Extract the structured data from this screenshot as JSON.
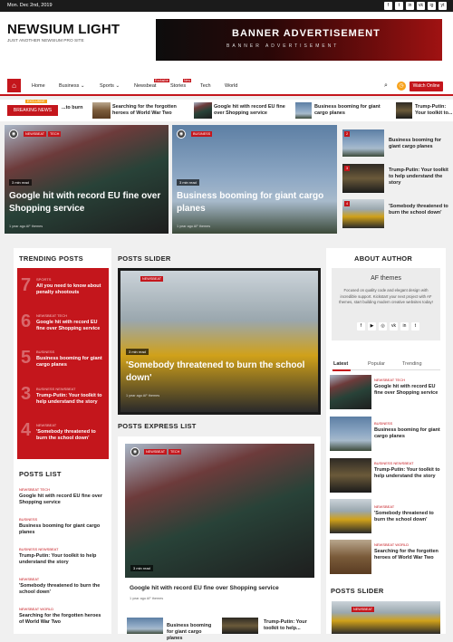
{
  "topbar": {
    "date": "Mon. Dec 2nd, 2019",
    "social": [
      "f",
      "t",
      "in",
      "vk",
      "ig",
      "yt"
    ]
  },
  "header": {
    "logo": "NEWSIUM LIGHT",
    "tagline": "JUST ANOTHER NEWSIUM PRO SITE",
    "banner_title": "BANNER ADVERTISEMENT",
    "banner_sub": "BANNER ADVERTISEMENT"
  },
  "nav": {
    "items": [
      "Home",
      "Business",
      "Sports",
      "Newsbeat",
      "Stories",
      "Tech",
      "World"
    ],
    "badge_newsbeat": "Exclusive",
    "badge_stories": "New",
    "watch": "Watch Online"
  },
  "breaking": {
    "label": "BREAKING NEWS",
    "exclusive": "EXCLUSIVE",
    "items": [
      "...to burn",
      "Searching for the forgotten heroes of World War Two",
      "Google hit with record EU fine over Shopping service",
      "Business booming for giant cargo planes",
      "Trump-Putin: Your toolkit to..."
    ]
  },
  "hero": {
    "left": {
      "cats": [
        "NEWSBEAT",
        "TECH"
      ],
      "read": "3 min read",
      "title": "Google hit with record EU fine over Shopping service",
      "meta": "1 year ago  AF themes"
    },
    "mid": {
      "cats": [
        "BUSINESS"
      ],
      "read": "3 min read",
      "title": "Business booming for giant cargo planes",
      "meta": "1 year ago  AF themes"
    },
    "side": [
      {
        "n": "2",
        "title": "Business booming for giant cargo planes"
      },
      {
        "n": "3",
        "title": "Trump-Putin: Your toolkit to help understand the story"
      },
      {
        "n": "4",
        "title": "'Somebody threatened to burn the school down'"
      }
    ]
  },
  "trending": {
    "title": "TRENDING POSTS",
    "items": [
      {
        "n": "7",
        "cat": "SPORTS",
        "title": "All you need to know about penalty shootouts"
      },
      {
        "n": "6",
        "cat": "NEWSBEAT  TECH",
        "title": "Google hit with record EU fine over Shopping service"
      },
      {
        "n": "5",
        "cat": "BUSINESS",
        "title": "Business booming for giant cargo planes"
      },
      {
        "n": "3",
        "cat": "BUSINESS  NEWSBEAT",
        "title": "Trump-Putin: Your toolkit to help understand the story"
      },
      {
        "n": "4",
        "cat": "NEWSBEAT",
        "title": "'Somebody threatened to burn the school down'"
      }
    ]
  },
  "posts_list": {
    "title": "POSTS LIST",
    "items": [
      {
        "cat": "NEWSBEAT  TECH",
        "title": "Google hit with record EU fine over Shopping service"
      },
      {
        "cat": "BUSINESS",
        "title": "Business booming for giant cargo planes"
      },
      {
        "cat": "BUSINESS  NEWSBEAT",
        "title": "Trump-Putin: Your toolkit to help understand the story"
      },
      {
        "cat": "NEWSBEAT",
        "title": "'Somebody threatened to burn the school down'"
      },
      {
        "cat": "NEWSBEAT  WORLD",
        "title": "Searching for the forgotten heroes of World War Two"
      }
    ]
  },
  "slider": {
    "title": "POSTS SLIDER",
    "cat": "NEWSBEAT",
    "read": "3 min read",
    "post_title": "'Somebody threatened to burn the school down'",
    "meta": "1 year ago  AF themes"
  },
  "express": {
    "title": "POSTS EXPRESS LIST",
    "cats": [
      "NEWSBEAT",
      "TECH"
    ],
    "read": "3 min read",
    "post_title": "Google hit with record EU fine over Shopping service",
    "meta": "1 year ago  AF themes",
    "sub1": "Business booming for giant cargo planes",
    "sub2": "Trump-Putin: Your toolkit to help..."
  },
  "author": {
    "title": "ABOUT AUTHOR",
    "name": "AF themes",
    "bio": "Focused on quality code and elegant design with incredible support. Kickstart your next project with AF themes, start building modern creative websites today!"
  },
  "tabs": {
    "items": [
      "Latest",
      "Popular",
      "Trending"
    ],
    "list": [
      {
        "cat": "NEWSBEAT  TECH",
        "title": "Google hit with record EU fine over Shopping service"
      },
      {
        "cat": "BUSINESS",
        "title": "Business booming for giant cargo planes"
      },
      {
        "cat": "BUSINESS  NEWSBEAT",
        "title": "Trump-Putin: Your toolkit to help understand the story"
      },
      {
        "cat": "NEWSBEAT",
        "title": "'Somebody threatened to burn the school down'"
      },
      {
        "cat": "NEWSBEAT  WORLD",
        "title": "Searching for the forgotten heroes of World War Two"
      }
    ]
  },
  "right_slider": {
    "title": "POSTS SLIDER",
    "cat": "NEWSBEAT"
  }
}
